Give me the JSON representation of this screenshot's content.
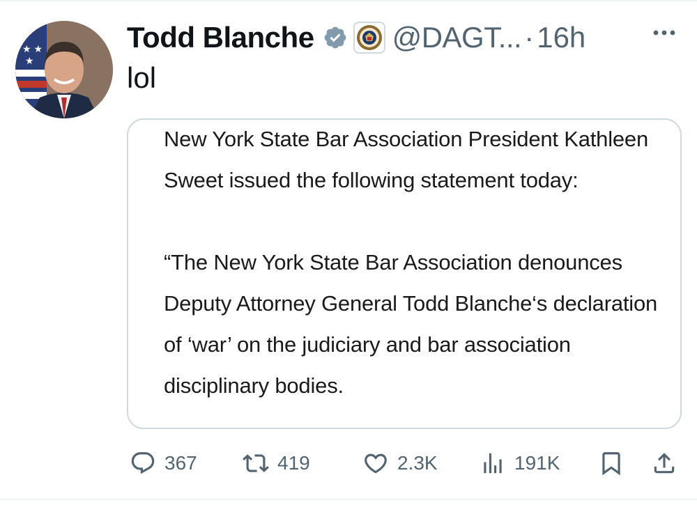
{
  "tweet": {
    "display_name": "Todd Blanche",
    "handle": "@DAGT...",
    "separator": "·",
    "timestamp": "16h",
    "text": "lol"
  },
  "quote": {
    "paragraphs": [
      "New York State Bar Association President Kathleen Sweet issued the following statement today:",
      "“The New York State Bar Association denounces Deputy Attorney General Todd Blanche‘s declaration of ‘war’ on the judiciary and bar association disciplinary bodies."
    ]
  },
  "actions": {
    "replies": "367",
    "reposts": "419",
    "likes": "2.3K",
    "views": "191K"
  },
  "icons": {
    "verified": "verified-badge-icon",
    "affiliation": "doj-seal-icon",
    "more": "more-icon",
    "reply": "reply-icon",
    "repost": "repost-icon",
    "like": "like-icon",
    "views": "views-icon",
    "bookmark": "bookmark-icon",
    "share": "share-icon"
  },
  "colors": {
    "text": "#0f1419",
    "secondary": "#536471",
    "verified": "#829aab",
    "border": "#cfd9de"
  }
}
